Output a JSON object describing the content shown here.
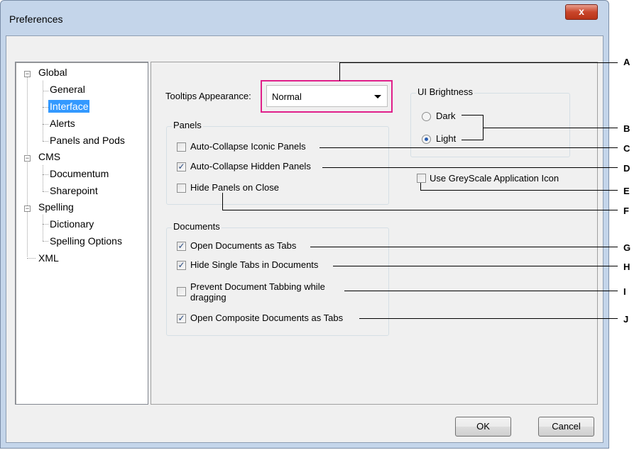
{
  "window": {
    "title": "Preferences",
    "close_label": "x"
  },
  "tree": {
    "items": [
      {
        "label": "Global"
      },
      {
        "label": "General"
      },
      {
        "label": "Interface"
      },
      {
        "label": "Alerts"
      },
      {
        "label": "Panels and Pods"
      },
      {
        "label": "CMS"
      },
      {
        "label": "Documentum"
      },
      {
        "label": "Sharepoint"
      },
      {
        "label": "Spelling"
      },
      {
        "label": "Dictionary"
      },
      {
        "label": "Spelling Options"
      },
      {
        "label": "XML"
      }
    ],
    "selected": "Interface"
  },
  "tooltips": {
    "label": "Tooltips Appearance:",
    "value": "Normal"
  },
  "panels": {
    "title": "Panels",
    "auto_collapse_iconic": {
      "label": "Auto-Collapse Iconic Panels",
      "checked": false
    },
    "auto_collapse_hidden": {
      "label": "Auto-Collapse Hidden Panels",
      "checked": true
    },
    "hide_on_close": {
      "label": "Hide Panels on Close",
      "checked": false
    }
  },
  "brightness": {
    "title": "UI Brightness",
    "dark": {
      "label": "Dark",
      "selected": false
    },
    "light": {
      "label": "Light",
      "selected": true
    }
  },
  "greyscale_icon": {
    "label": "Use GreyScale Application Icon",
    "checked": false
  },
  "documents": {
    "title": "Documents",
    "open_as_tabs": {
      "label": "Open Documents as Tabs",
      "checked": true
    },
    "hide_single_tabs": {
      "label": "Hide Single Tabs in Documents",
      "checked": true
    },
    "prevent_tabbing_line1": "Prevent Document Tabbing while",
    "prevent_tabbing_line2": "dragging",
    "prevent_tabbing_checked": false,
    "open_composite": {
      "label": "Open Composite Documents as Tabs",
      "checked": true
    }
  },
  "buttons": {
    "ok": "OK",
    "cancel": "Cancel"
  },
  "callouts": [
    "A",
    "B",
    "C",
    "D",
    "E",
    "F",
    "G",
    "H",
    "I",
    "J"
  ],
  "check_glyph": "✓",
  "colors": {
    "selection": "#3399ff",
    "highlight": "#e0208a",
    "window_frame": "#c4d5ea"
  }
}
